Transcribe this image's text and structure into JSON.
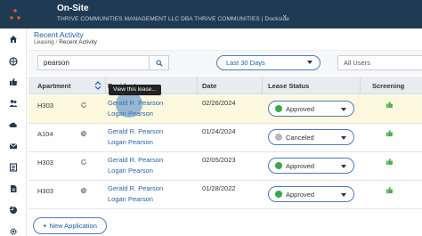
{
  "header": {
    "app_name": "On-Site",
    "company": "THRIVE COMMUNITIES MANAGEMENT LLC DBA THRIVE COMMUNITIES | Dockside"
  },
  "sidebar": {
    "items": [
      {
        "icon": "home-icon"
      },
      {
        "icon": "globe-icon"
      },
      {
        "icon": "thumbs-up-icon"
      },
      {
        "icon": "users-icon"
      },
      {
        "icon": "cloud-icon"
      },
      {
        "icon": "envelope-icon"
      },
      {
        "icon": "list-icon"
      },
      {
        "icon": "document-icon"
      },
      {
        "icon": "pie-chart-icon"
      },
      {
        "icon": "gear-icon"
      }
    ]
  },
  "page": {
    "title": "Recent Activity",
    "breadcrumb_parent": "Leasing",
    "breadcrumb_sep": "/",
    "breadcrumb_current": "Recent Activity"
  },
  "filters": {
    "search_value": "pearson",
    "date_range": "Last 30 Days",
    "users": "All Users"
  },
  "table": {
    "headers": {
      "apartment": "Apartment",
      "residents": "Residents",
      "date": "Date",
      "lease_status": "Lease Status",
      "screening": "Screening"
    },
    "rows": [
      {
        "apartment": "H303",
        "type_icon": "refresh-icon",
        "resident_1": "Gerald R. Pearson",
        "resident_2": "Logan Pearson",
        "date": "02/26/2024",
        "status": "Approved",
        "status_color": "#3aa84a"
      },
      {
        "apartment": "A104",
        "type_icon": "globe-icon",
        "resident_1": "Gerald R. Pearson",
        "resident_2": "Logan Pearson",
        "date": "01/24/2024",
        "status": "Canceled",
        "status_color": "#b5b9bf"
      },
      {
        "apartment": "H303",
        "type_icon": "refresh-icon",
        "resident_1": "Gerald R. Pearson",
        "resident_2": "Logan Pearson",
        "date": "02/05/2023",
        "status": "Approved",
        "status_color": "#3aa84a"
      },
      {
        "apartment": "H303",
        "type_icon": "globe-icon",
        "resident_1": "Gerald R. Pearson",
        "resident_2": "Logan Pearson",
        "date": "01/28/2022",
        "status": "Approved",
        "status_color": "#3aa84a"
      }
    ]
  },
  "tooltip": "View this lease...",
  "new_application_label": "New Application",
  "colors": {
    "header_bg": "#1f3a53",
    "accent": "#1a5fa8",
    "approved": "#3aa84a",
    "screening": "#4caf50",
    "highlight_row": "#fbf8de"
  }
}
